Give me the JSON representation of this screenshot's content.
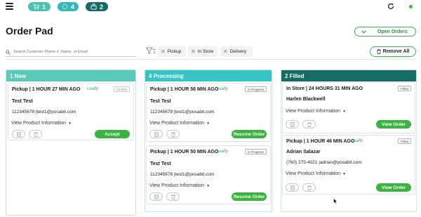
{
  "topbar": {
    "pills": [
      {
        "count": "1",
        "icon": "cart-icon",
        "color": "#49c3b2"
      },
      {
        "count": "4",
        "icon": "spinner-icon",
        "color": "#34b8b9"
      },
      {
        "count": "2",
        "icon": "bag-icon",
        "color": "#176b65"
      }
    ],
    "status_color": "#35c23d"
  },
  "page": {
    "title": "Order Pad",
    "open_orders_label": "Open Orders"
  },
  "search": {
    "placeholder": "Search Customer Phone #, Name, or Email"
  },
  "filters": {
    "chips": [
      "Pickup",
      "In Store",
      "Delivery"
    ],
    "remove_all_label": "Remove All"
  },
  "columns": [
    {
      "header": "1 New",
      "color": "#5bc9b7",
      "cards": [
        {
          "title": "Pickup | 1 HOUR 27 MIN AGO",
          "source": "Leafly",
          "badge": "Verified",
          "customer": "Test Test",
          "contact": "112345678 |test1@posabit.com",
          "details_label": "View Product Information",
          "action_label": "Accept"
        }
      ]
    },
    {
      "header": "4 Processing",
      "color": "#36c4c4",
      "cards": [
        {
          "title": "Pickup | 1 HOUR 56 MIN AGO",
          "source": "Leafly",
          "badge": "In Progress",
          "customer": "Test Test",
          "contact": "112345678 |test1@posabit.com",
          "details_label": "View Product Information",
          "action_label": "Resume Order"
        },
        {
          "title": "Pickup | 1 HOUR 50 MIN AGO",
          "source": "Leafly",
          "badge": "In Progress",
          "customer": "Test Test",
          "contact": "112345678 |test1@posabit.com",
          "details_label": "View Product Information",
          "action_label": "Resume Order"
        }
      ]
    },
    {
      "header": "2 Filled",
      "color": "#176b65",
      "cards": [
        {
          "title": "In Store | 24 HOURS 31 MIN AGO",
          "source": "",
          "badge": "Filled",
          "customer": "Harlen Blackwell",
          "contact": "",
          "details_label": "View Product Information",
          "action_label": "View Order"
        },
        {
          "title": "Pickup | 1 HOUR 46 MIN AGO",
          "source": "Leafly",
          "badge": "Filled",
          "customer": "Adrian Salazar",
          "contact": "(760) 275-4021 |adrian@posabit.com",
          "details_label": "View Product Information",
          "action_label": "View Order"
        }
      ]
    }
  ]
}
